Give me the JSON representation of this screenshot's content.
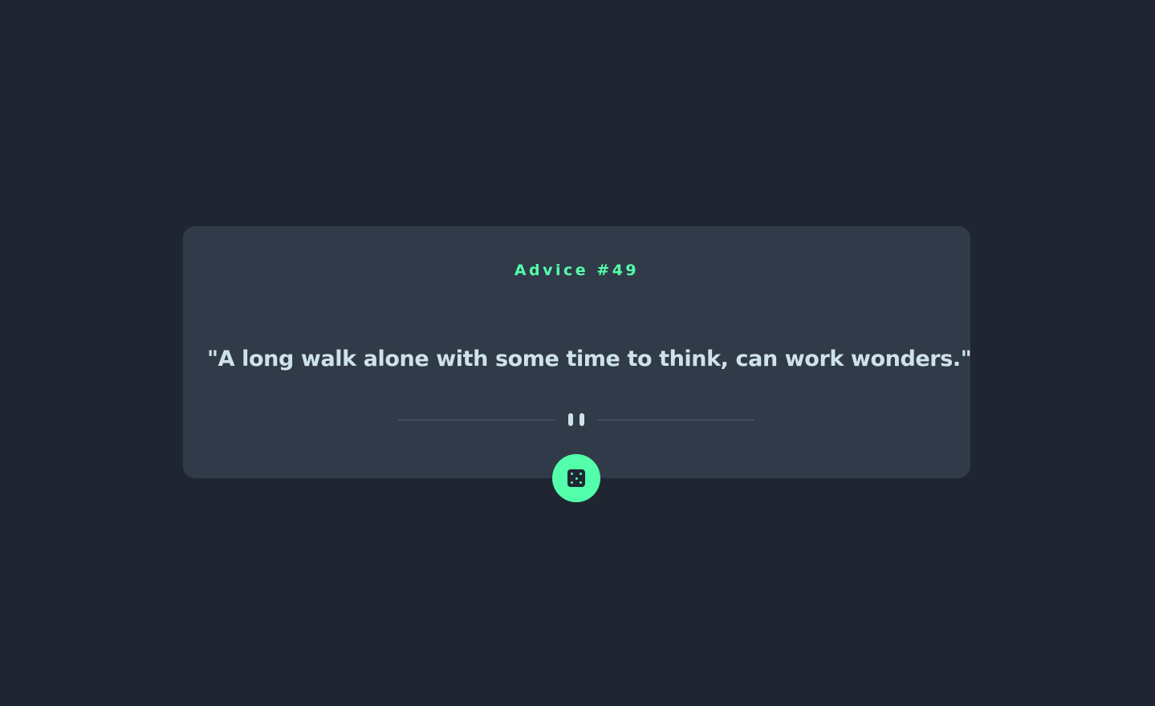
{
  "advice": {
    "id_label": "Advice #49",
    "quote": "\"A long walk alone with some time to think, can work wonders.\""
  },
  "controls": {
    "dice_button_icon": "dice-icon"
  },
  "colors": {
    "background": "#1F2632",
    "card": "#313A48",
    "accent": "#53FFAA",
    "text": "#CEE3E9",
    "divider": "#4F5D74"
  }
}
